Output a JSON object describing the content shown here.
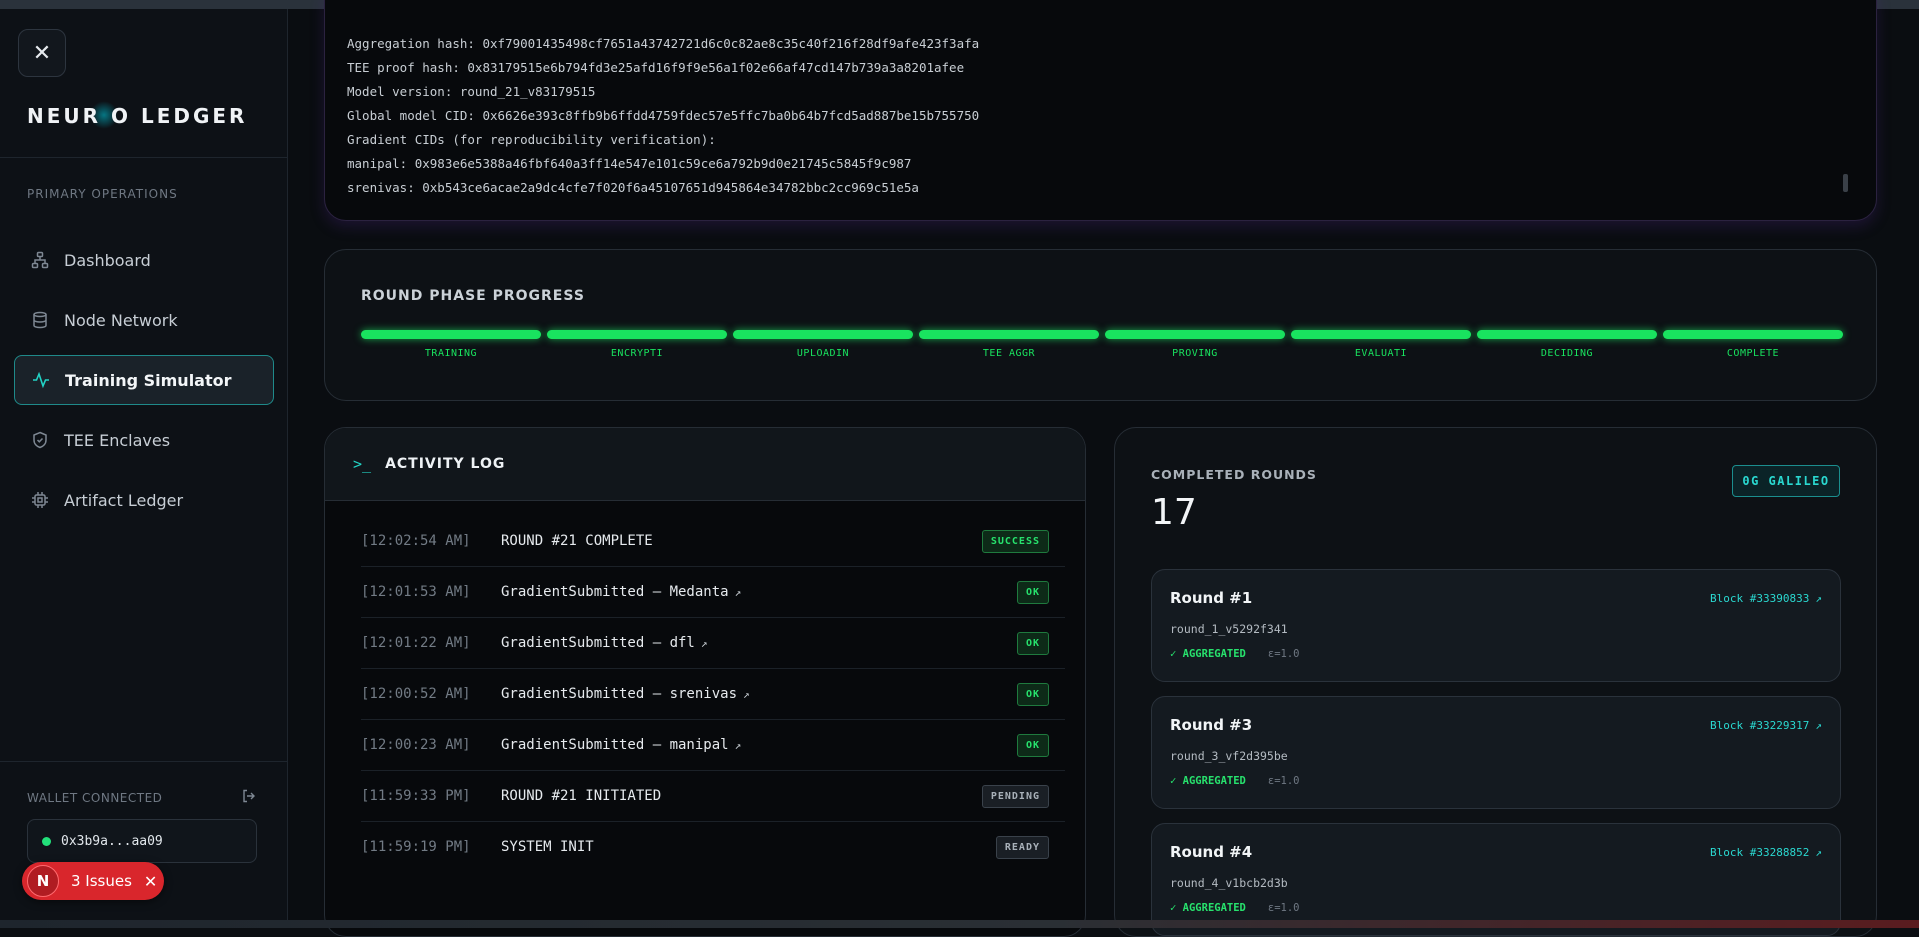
{
  "sidebar": {
    "logo": "NEUR O LEDGER",
    "section_label": "PRIMARY OPERATIONS",
    "items": [
      {
        "label": "Dashboard",
        "icon": "sitemap-icon"
      },
      {
        "label": "Node Network",
        "icon": "database-icon"
      },
      {
        "label": "Training Simulator",
        "icon": "activity-icon",
        "active": true
      },
      {
        "label": "TEE Enclaves",
        "icon": "shield-icon"
      },
      {
        "label": "Artifact Ledger",
        "icon": "chip-icon"
      }
    ],
    "wallet_label": "WALLET CONNECTED",
    "wallet_address": "0x3b9a...aa09",
    "issues_initial": "N",
    "issues_label": "3 Issues"
  },
  "proof": {
    "lines": [
      "Aggregation hash: 0xf79001435498cf7651a43742721d6c0c82ae8c35c40f216f28df9afe423f3afa",
      "TEE proof hash: 0x83179515e6b794fd3e25afd16f9f9e56a1f02e66af47cd147b739a3a8201afee",
      "Model version: round_21_v83179515",
      "Global model CID: 0x6626e393c8ffb9b6ffdd4759fdec57e5ffc7ba0b64b7fcd5ad887be15b755750",
      "Gradient CIDs (for reproducibility verification):",
      "manipal: 0x983e6e5388a46fbf640a3ff14e547e101c59ce6a792b9d0e21745c5845f9c987",
      "srenivas: 0xb543ce6acae2a9dc4cfe7f020f6a45107651d945864e34782bbc2cc969c51e5a"
    ]
  },
  "phase": {
    "title": "ROUND PHASE PROGRESS",
    "phases": [
      "TRAINING",
      "ENCRYPTI",
      "UPLOADIN",
      "TEE AGGR",
      "PROVING",
      "EVALUATI",
      "DECIDING",
      "COMPLETE"
    ],
    "color": "#19e35f"
  },
  "log": {
    "title": "ACTIVITY LOG",
    "entries": [
      {
        "time": "[12:02:54 AM]",
        "message": "ROUND #21 COMPLETE",
        "badge": "SUCCESS",
        "link": false
      },
      {
        "time": "[12:01:53 AM]",
        "message": "GradientSubmitted – Medanta",
        "badge": "OK",
        "link": true
      },
      {
        "time": "[12:01:22 AM]",
        "message": "GradientSubmitted – dfl",
        "badge": "OK",
        "link": true
      },
      {
        "time": "[12:00:52 AM]",
        "message": "GradientSubmitted – srenivas",
        "badge": "OK",
        "link": true
      },
      {
        "time": "[12:00:23 AM]",
        "message": "GradientSubmitted – manipal",
        "badge": "OK",
        "link": true
      },
      {
        "time": "[11:59:33 PM]",
        "message": "ROUND #21 INITIATED",
        "badge": "PENDING",
        "link": false
      },
      {
        "time": "[11:59:19 PM]",
        "message": "SYSTEM INIT",
        "badge": "READY",
        "link": false
      }
    ]
  },
  "rounds": {
    "label": "COMPLETED ROUNDS",
    "count": "17",
    "network": "0G GALILEO",
    "items": [
      {
        "title": "Round #1",
        "block": "Block #33390833",
        "version": "round_1_v5292f341",
        "status": "AGGREGATED",
        "epsilon": "ε=1.0"
      },
      {
        "title": "Round #3",
        "block": "Block #33229317",
        "version": "round_3_vf2d395be",
        "status": "AGGREGATED",
        "epsilon": "ε=1.0"
      },
      {
        "title": "Round #4",
        "block": "Block #33288852",
        "version": "round_4_v1bcb2d3b",
        "status": "AGGREGATED",
        "epsilon": "ε=1.0"
      }
    ]
  },
  "colors": {
    "accent": "#22d3c5",
    "success": "#27e26d",
    "issues": "#d9262c"
  }
}
